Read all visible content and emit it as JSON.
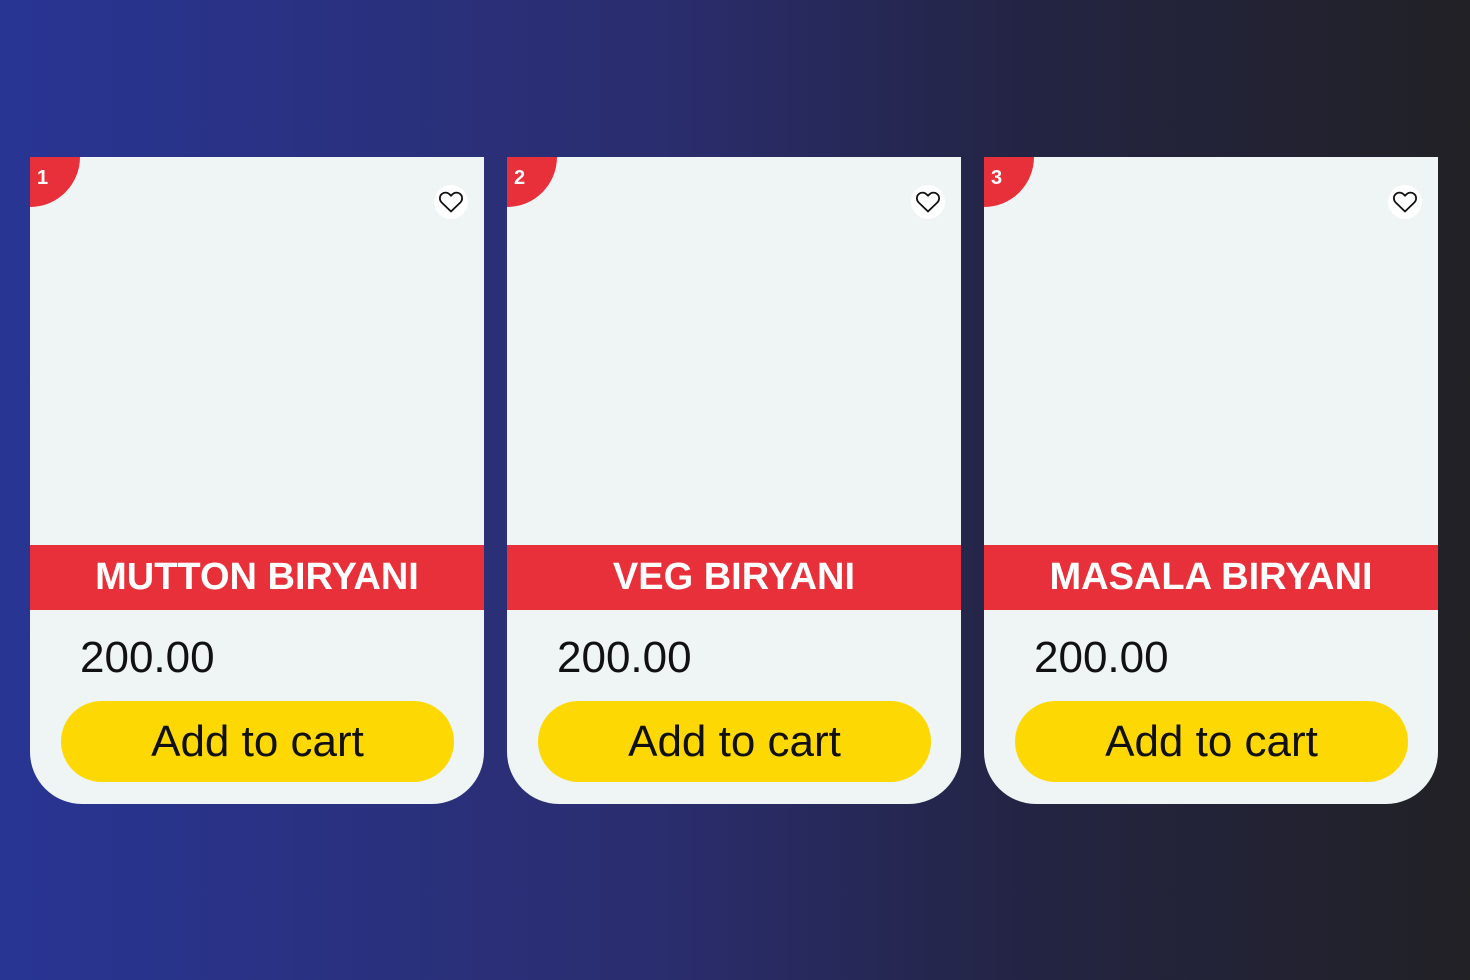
{
  "colors": {
    "accent_red": "#e8303a",
    "button_yellow": "#fdd803",
    "card_background": "#eff5f5",
    "background_gradient_start": "#283593",
    "background_gradient_end": "#222126"
  },
  "icons": {
    "favorite": "heart-outline-icon"
  },
  "products": [
    {
      "rank": "1",
      "name": "MUTTON BIRYANI",
      "price": "200.00",
      "add_to_cart_label": "Add to cart"
    },
    {
      "rank": "2",
      "name": "VEG BIRYANI",
      "price": "200.00",
      "add_to_cart_label": "Add to cart"
    },
    {
      "rank": "3",
      "name": "MASALA BIRYANI",
      "price": "200.00",
      "add_to_cart_label": "Add to cart"
    }
  ]
}
